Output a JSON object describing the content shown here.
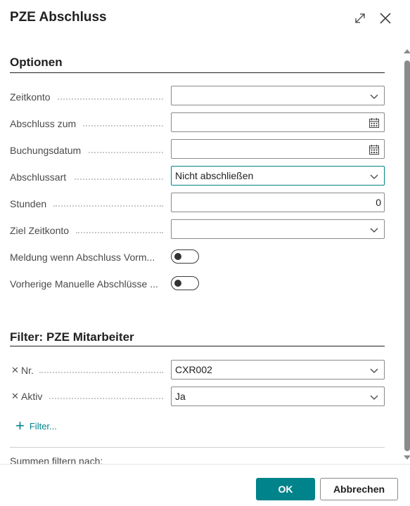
{
  "dialog": {
    "title": "PZE Abschluss"
  },
  "options": {
    "title": "Optionen",
    "fields": {
      "zeitkonto": {
        "label": "Zeitkonto",
        "value": ""
      },
      "abschluss_zum": {
        "label": "Abschluss zum",
        "value": ""
      },
      "buchungsdatum": {
        "label": "Buchungsdatum",
        "value": ""
      },
      "abschlussart": {
        "label": "Abschlussart",
        "value": "Nicht abschließen"
      },
      "stunden": {
        "label": "Stunden",
        "value": "0"
      },
      "ziel_zeitkonto": {
        "label": "Ziel Zeitkonto",
        "value": ""
      },
      "meldung": {
        "label": "Meldung wenn Abschluss Vorm...",
        "enabled": false
      },
      "vorherige": {
        "label": "Vorherige Manuelle Abschlüsse ...",
        "enabled": false
      }
    }
  },
  "filter": {
    "title": "Filter: PZE Mitarbeiter",
    "nr": {
      "label": "Nr.",
      "value": "CXR002"
    },
    "aktiv": {
      "label": "Aktiv",
      "value": "Ja"
    },
    "add_label": "Filter..."
  },
  "summen": {
    "label": "Summen filtern nach:"
  },
  "buttons": {
    "ok": "OK",
    "cancel": "Abbrechen"
  },
  "colors": {
    "accent": "#00838a",
    "text": "#212121",
    "label": "#4a4a4a"
  }
}
